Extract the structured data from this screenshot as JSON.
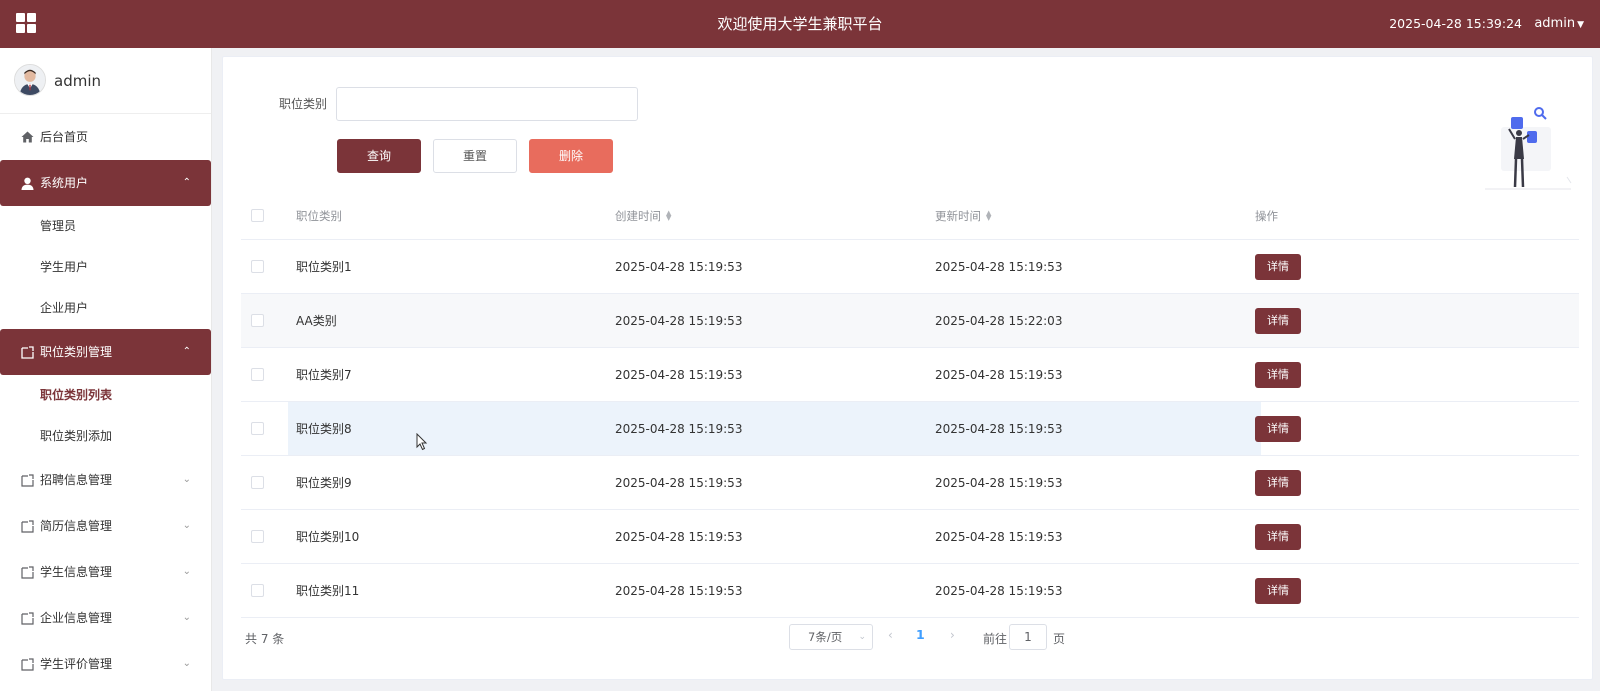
{
  "header": {
    "title": "欢迎使用大学生兼职平台",
    "datetime": "2025-04-28 15:39:24",
    "user": "admin",
    "menu_icon": "grid-icon"
  },
  "sidebar": {
    "profile_name": "admin",
    "items": [
      {
        "label": "后台首页",
        "icon": "home-icon"
      },
      {
        "label": "系统用户",
        "icon": "user-icon",
        "expanded": true
      },
      {
        "label": "管理员"
      },
      {
        "label": "学生用户"
      },
      {
        "label": "企业用户"
      },
      {
        "label": "职位类别管理",
        "icon": "folder-icon",
        "expanded": true
      },
      {
        "label": "职位类别列表",
        "selected": true
      },
      {
        "label": "职位类别添加"
      },
      {
        "label": "招聘信息管理",
        "icon": "folder-icon"
      },
      {
        "label": "简历信息管理",
        "icon": "folder-icon"
      },
      {
        "label": "学生信息管理",
        "icon": "folder-icon"
      },
      {
        "label": "企业信息管理",
        "icon": "folder-icon"
      },
      {
        "label": "学生评价管理",
        "icon": "folder-icon"
      }
    ]
  },
  "search": {
    "label": "职位类别",
    "value": "",
    "query_label": "查询",
    "reset_label": "重置",
    "delete_label": "删除"
  },
  "table": {
    "headers": {
      "name": "职位类别",
      "created": "创建时间",
      "updated": "更新时间",
      "operation": "操作"
    },
    "detail_label": "详情",
    "rows": [
      {
        "name": "职位类别1",
        "created": "2025-04-28 15:19:53",
        "updated": "2025-04-28 15:19:53"
      },
      {
        "name": "AA类别",
        "created": "2025-04-28 15:19:53",
        "updated": "2025-04-28 15:22:03"
      },
      {
        "name": "职位类别7",
        "created": "2025-04-28 15:19:53",
        "updated": "2025-04-28 15:19:53"
      },
      {
        "name": "职位类别8",
        "created": "2025-04-28 15:19:53",
        "updated": "2025-04-28 15:19:53"
      },
      {
        "name": "职位类别9",
        "created": "2025-04-28 15:19:53",
        "updated": "2025-04-28 15:19:53"
      },
      {
        "name": "职位类别10",
        "created": "2025-04-28 15:19:53",
        "updated": "2025-04-28 15:19:53"
      },
      {
        "name": "职位类别11",
        "created": "2025-04-28 15:19:53",
        "updated": "2025-04-28 15:19:53"
      }
    ]
  },
  "pagination": {
    "total": "共 7 条",
    "page_size": "7条/页",
    "current_page": "1",
    "goto_label": "前往",
    "goto_value": "1",
    "goto_suffix": "页"
  },
  "colors": {
    "primary": "#7b3439",
    "danger": "#e86c5d",
    "link": "#409eff"
  }
}
